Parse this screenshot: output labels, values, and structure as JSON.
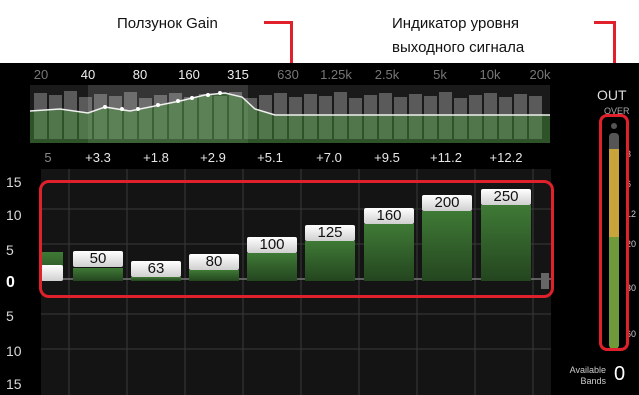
{
  "callouts": {
    "gain_slider": "Ползунок Gain",
    "output_meter_line1": "Индикатор уровня",
    "output_meter_line2": "выходного сигнала"
  },
  "freq_labels": [
    "20",
    "40",
    "80",
    "160",
    "315",
    "630",
    "1.25k",
    "2.5k",
    "5k",
    "10k",
    "20k"
  ],
  "band_values": [
    "5",
    "+3.3",
    "+1.8",
    "+2.9",
    "+5.1",
    "+7.0",
    "+9.5",
    "+11.2",
    "+12.2"
  ],
  "gain_scale": [
    "15",
    "10",
    "5",
    "0",
    "5",
    "10",
    "15"
  ],
  "sliders": [
    {
      "label": "",
      "gain": 3.3
    },
    {
      "label": "50",
      "gain": 1.8
    },
    {
      "label": "63",
      "gain": 0.5
    },
    {
      "label": "80",
      "gain": 2.9
    },
    {
      "label": "100",
      "gain": 5.1
    },
    {
      "label": "125",
      "gain": 7.0
    },
    {
      "label": "160",
      "gain": 9.5
    },
    {
      "label": "200",
      "gain": 11.2
    },
    {
      "label": "250",
      "gain": 12.2
    }
  ],
  "meter": {
    "title": "OUT",
    "over": "OVER",
    "ticks": [
      "3",
      "6",
      "12",
      "20",
      "30",
      "60"
    ]
  },
  "available_bands": {
    "label_line1": "Available",
    "label_line2": "Bands",
    "value": "0"
  },
  "colors": {
    "highlight": "#e0202a",
    "bar": "#3f7a36",
    "curve": "#5fbf4a",
    "meter_yellow": "#c9a43a",
    "meter_green": "#6f9a3a"
  }
}
